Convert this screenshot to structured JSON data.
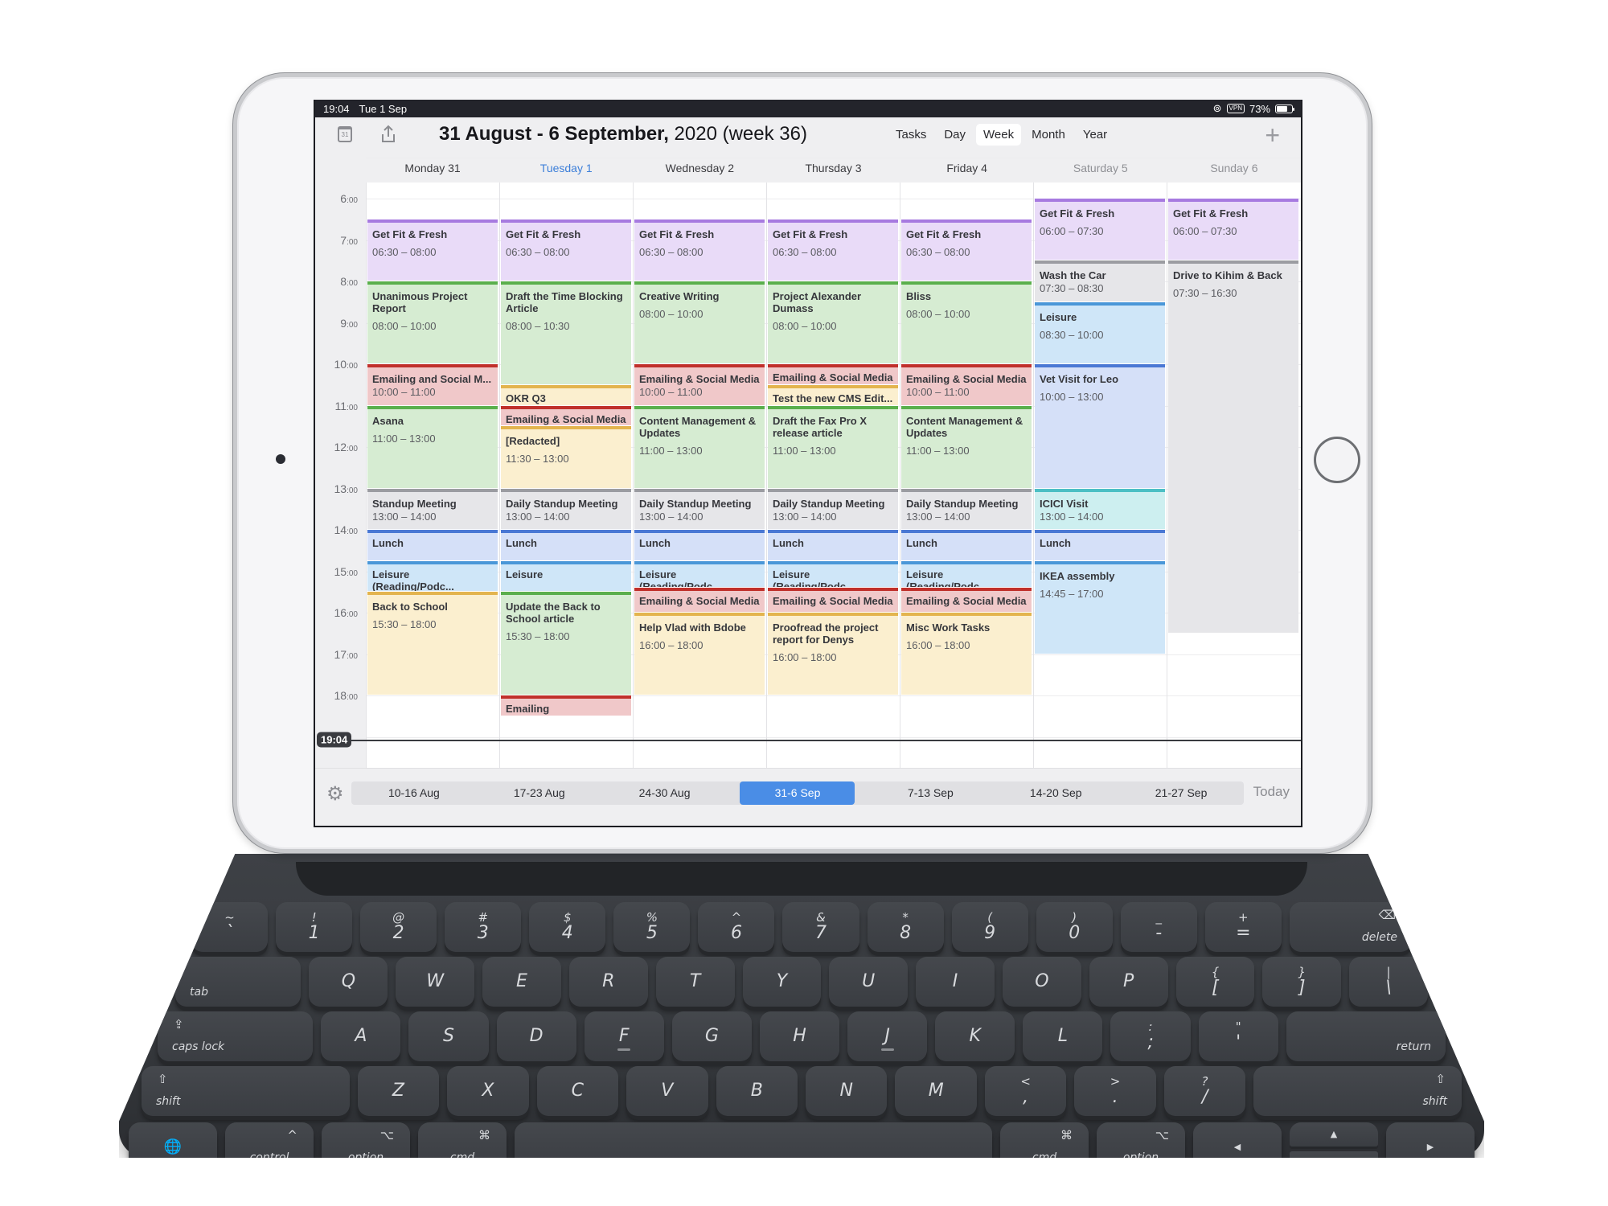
{
  "status_bar": {
    "time": "19:04",
    "date": "Tue 1 Sep",
    "vpn_label": "VPN",
    "battery_percent": "73%",
    "battery_level": 0.73
  },
  "toolbar": {
    "title_bold": "31 August - 6 September,",
    "title_rest": " 2020 (week 36)",
    "calendar_icon_day": "31",
    "view_tabs": [
      {
        "label": "Tasks",
        "active": false
      },
      {
        "label": "Day",
        "active": false
      },
      {
        "label": "Week",
        "active": true
      },
      {
        "label": "Month",
        "active": false
      },
      {
        "label": "Year",
        "active": false
      }
    ],
    "add_label": "+"
  },
  "days": [
    {
      "label": "Monday 31",
      "state": "normal"
    },
    {
      "label": "Tuesday 1",
      "state": "today"
    },
    {
      "label": "Wednesday 2",
      "state": "normal"
    },
    {
      "label": "Thursday 3",
      "state": "normal"
    },
    {
      "label": "Friday 4",
      "state": "normal"
    },
    {
      "label": "Saturday 5",
      "state": "weekend"
    },
    {
      "label": "Sunday 6",
      "state": "weekend"
    }
  ],
  "hours": [
    "6",
    "7",
    "8",
    "9",
    "10",
    "11",
    "12",
    "13",
    "14",
    "15",
    "16",
    "17",
    "18"
  ],
  "hour_suffix": ":00",
  "now": {
    "label": "19:04",
    "hour": 19.0667
  },
  "colors": {
    "purple": {
      "bg": "#e9dbf8",
      "bar": "#a77ae0"
    },
    "green": {
      "bg": "#d6ecd2",
      "bar": "#5aaf4c"
    },
    "red": {
      "bg": "#f0c8c9",
      "bar": "#c0302b"
    },
    "yellow": {
      "bg": "#fbefcf",
      "bar": "#e3b44e"
    },
    "gray": {
      "bg": "#e6e6e9",
      "bar": "#9b9ca1"
    },
    "blue": {
      "bg": "#d5e0f8",
      "bar": "#4a78d4"
    },
    "sky": {
      "bg": "#cfe6f8",
      "bar": "#4a97d8"
    },
    "teal": {
      "bg": "#cdeff0",
      "bar": "#4bbfc4"
    },
    "accent": "#4a8de6",
    "today_text": "#3d7fd9"
  },
  "events": [
    {
      "day": 0,
      "title": "Get Fit & Fresh",
      "time": "06:30 – 08:00",
      "start": 6.5,
      "end": 8,
      "color": "purple"
    },
    {
      "day": 0,
      "title": "Unanimous Project Report",
      "time": "08:00 – 10:00",
      "start": 8,
      "end": 10,
      "color": "green"
    },
    {
      "day": 0,
      "title": "Emailing and Social M...",
      "time": "10:00 – 11:00",
      "start": 10,
      "end": 11,
      "color": "red",
      "compact": true
    },
    {
      "day": 0,
      "title": "Asana",
      "time": "11:00 – 13:00",
      "start": 11,
      "end": 13,
      "color": "green"
    },
    {
      "day": 0,
      "title": "Standup Meeting",
      "time": "13:00 – 14:00",
      "start": 13,
      "end": 14,
      "color": "gray",
      "compact": true
    },
    {
      "day": 0,
      "title": "Lunch",
      "time": "",
      "start": 14,
      "end": 14.75,
      "color": "blue"
    },
    {
      "day": 0,
      "title": "Leisure (Reading/Podc...",
      "time": "",
      "start": 14.75,
      "end": 15.5,
      "color": "sky"
    },
    {
      "day": 0,
      "title": "Back to School",
      "time": "15:30 – 18:00",
      "start": 15.5,
      "end": 18,
      "color": "yellow"
    },
    {
      "day": 1,
      "title": "Get Fit & Fresh",
      "time": "06:30 – 08:00",
      "start": 6.5,
      "end": 8,
      "color": "purple"
    },
    {
      "day": 1,
      "title": "Draft the Time Blocking Article",
      "time": "08:00 – 10:30",
      "start": 8,
      "end": 10.5,
      "color": "green"
    },
    {
      "day": 1,
      "title": "OKR Q3",
      "time": "",
      "start": 10.5,
      "end": 11,
      "color": "yellow"
    },
    {
      "day": 1,
      "title": "Emailing & Social Media",
      "time": "",
      "start": 11,
      "end": 11.5,
      "color": "red"
    },
    {
      "day": 1,
      "title": "[Redacted]",
      "time": "11:30 – 13:00",
      "start": 11.5,
      "end": 13,
      "color": "yellow"
    },
    {
      "day": 1,
      "title": "Daily Standup Meeting",
      "time": "13:00 – 14:00",
      "start": 13,
      "end": 14,
      "color": "gray",
      "compact": true
    },
    {
      "day": 1,
      "title": "Lunch",
      "time": "",
      "start": 14,
      "end": 14.75,
      "color": "blue"
    },
    {
      "day": 1,
      "title": "Leisure",
      "time": "",
      "start": 14.75,
      "end": 15.5,
      "color": "sky"
    },
    {
      "day": 1,
      "title": "Update the Back to School article",
      "time": "15:30 – 18:00",
      "start": 15.5,
      "end": 18,
      "color": "green"
    },
    {
      "day": 1,
      "title": "Emailing",
      "time": "",
      "start": 18,
      "end": 18.5,
      "color": "red"
    },
    {
      "day": 2,
      "title": "Get Fit & Fresh",
      "time": "06:30 – 08:00",
      "start": 6.5,
      "end": 8,
      "color": "purple"
    },
    {
      "day": 2,
      "title": "Creative Writing",
      "time": "08:00 – 10:00",
      "start": 8,
      "end": 10,
      "color": "green"
    },
    {
      "day": 2,
      "title": "Emailing & Social Media",
      "time": "10:00 – 11:00",
      "start": 10,
      "end": 11,
      "color": "red",
      "compact": true
    },
    {
      "day": 2,
      "title": "Content Management & Updates",
      "time": "11:00 – 13:00",
      "start": 11,
      "end": 13,
      "color": "green"
    },
    {
      "day": 2,
      "title": "Daily Standup Meeting",
      "time": "13:00 – 14:00",
      "start": 13,
      "end": 14,
      "color": "gray",
      "compact": true
    },
    {
      "day": 2,
      "title": "Lunch",
      "time": "",
      "start": 14,
      "end": 14.75,
      "color": "blue"
    },
    {
      "day": 2,
      "title": "Leisure (Reading/Podc...",
      "time": "",
      "start": 14.75,
      "end": 15.4,
      "color": "sky"
    },
    {
      "day": 2,
      "title": "Emailing & Social Media",
      "time": "",
      "start": 15.4,
      "end": 16,
      "color": "red"
    },
    {
      "day": 2,
      "title": "Help Vlad with Bdobe",
      "time": "16:00 – 18:00",
      "start": 16,
      "end": 18,
      "color": "yellow"
    },
    {
      "day": 3,
      "title": "Get Fit & Fresh",
      "time": "06:30 – 08:00",
      "start": 6.5,
      "end": 8,
      "color": "purple"
    },
    {
      "day": 3,
      "title": "Project Alexander Dumass",
      "time": "08:00 – 10:00",
      "start": 8,
      "end": 10,
      "color": "green"
    },
    {
      "day": 3,
      "title": "Emailing & Social Media",
      "time": "",
      "start": 10,
      "end": 10.5,
      "color": "red"
    },
    {
      "day": 3,
      "title": "Test the new CMS Edit...",
      "time": "",
      "start": 10.5,
      "end": 11,
      "color": "yellow"
    },
    {
      "day": 3,
      "title": "Draft the Fax Pro X release article",
      "time": "11:00 – 13:00",
      "start": 11,
      "end": 13,
      "color": "green"
    },
    {
      "day": 3,
      "title": "Daily Standup Meeting",
      "time": "13:00 – 14:00",
      "start": 13,
      "end": 14,
      "color": "gray",
      "compact": true
    },
    {
      "day": 3,
      "title": "Lunch",
      "time": "",
      "start": 14,
      "end": 14.75,
      "color": "blue"
    },
    {
      "day": 3,
      "title": "Leisure (Reading/Podc...",
      "time": "",
      "start": 14.75,
      "end": 15.4,
      "color": "sky"
    },
    {
      "day": 3,
      "title": "Emailing & Social Media",
      "time": "",
      "start": 15.4,
      "end": 16,
      "color": "red"
    },
    {
      "day": 3,
      "title": "Proofread the project report for Denys",
      "time": "16:00 – 18:00",
      "start": 16,
      "end": 18,
      "color": "yellow"
    },
    {
      "day": 4,
      "title": "Get Fit & Fresh",
      "time": "06:30 – 08:00",
      "start": 6.5,
      "end": 8,
      "color": "purple"
    },
    {
      "day": 4,
      "title": "Bliss",
      "time": "08:00 – 10:00",
      "start": 8,
      "end": 10,
      "color": "green"
    },
    {
      "day": 4,
      "title": "Emailing & Social Media",
      "time": "10:00 – 11:00",
      "start": 10,
      "end": 11,
      "color": "red",
      "compact": true
    },
    {
      "day": 4,
      "title": "Content Management & Updates",
      "time": "11:00 – 13:00",
      "start": 11,
      "end": 13,
      "color": "green"
    },
    {
      "day": 4,
      "title": "Daily Standup Meeting",
      "time": "13:00 – 14:00",
      "start": 13,
      "end": 14,
      "color": "gray",
      "compact": true
    },
    {
      "day": 4,
      "title": "Lunch",
      "time": "",
      "start": 14,
      "end": 14.75,
      "color": "blue"
    },
    {
      "day": 4,
      "title": "Leisure (Reading/Podc...",
      "time": "",
      "start": 14.75,
      "end": 15.4,
      "color": "sky"
    },
    {
      "day": 4,
      "title": "Emailing & Social Media",
      "time": "",
      "start": 15.4,
      "end": 16,
      "color": "red"
    },
    {
      "day": 4,
      "title": "Misc Work Tasks",
      "time": "16:00 – 18:00",
      "start": 16,
      "end": 18,
      "color": "yellow"
    },
    {
      "day": 5,
      "title": "Get Fit & Fresh",
      "time": "06:00 – 07:30",
      "start": 6,
      "end": 7.5,
      "color": "purple"
    },
    {
      "day": 5,
      "title": "Wash the Car",
      "time": "07:30 – 08:30",
      "start": 7.5,
      "end": 8.5,
      "color": "gray",
      "compact": true
    },
    {
      "day": 5,
      "title": "Leisure",
      "time": "08:30 – 10:00",
      "start": 8.5,
      "end": 10,
      "color": "sky"
    },
    {
      "day": 5,
      "title": "Vet Visit for Leo",
      "time": "10:00 – 13:00",
      "start": 10,
      "end": 13,
      "color": "blue"
    },
    {
      "day": 5,
      "title": "ICICI Visit",
      "time": "13:00 – 14:00",
      "start": 13,
      "end": 14,
      "color": "teal",
      "compact": true
    },
    {
      "day": 5,
      "title": "Lunch",
      "time": "",
      "start": 14,
      "end": 14.75,
      "color": "blue"
    },
    {
      "day": 5,
      "title": "IKEA assembly",
      "time": "14:45 – 17:00",
      "start": 14.75,
      "end": 17,
      "color": "sky"
    },
    {
      "day": 6,
      "title": "Get Fit & Fresh",
      "time": "06:00 – 07:30",
      "start": 6,
      "end": 7.5,
      "color": "purple"
    },
    {
      "day": 6,
      "title": "Drive to Kihim & Back",
      "time": "07:30 – 16:30",
      "start": 7.5,
      "end": 16.5,
      "color": "gray"
    }
  ],
  "week_strip": {
    "weeks": [
      {
        "label": "10-16 Aug",
        "active": false
      },
      {
        "label": "17-23 Aug",
        "active": false
      },
      {
        "label": "24-30 Aug",
        "active": false
      },
      {
        "label": "31-6 Sep",
        "active": true
      },
      {
        "label": "7-13 Sep",
        "active": false
      },
      {
        "label": "14-20 Sep",
        "active": false
      },
      {
        "label": "21-27 Sep",
        "active": false
      }
    ],
    "today_label": "Today"
  },
  "keyboard": {
    "rows": [
      [
        {
          "main": "`",
          "shift": "~"
        },
        {
          "main": "1",
          "shift": "!"
        },
        {
          "main": "2",
          "shift": "@"
        },
        {
          "main": "3",
          "shift": "#"
        },
        {
          "main": "4",
          "shift": "$"
        },
        {
          "main": "5",
          "shift": "%"
        },
        {
          "main": "6",
          "shift": "^"
        },
        {
          "main": "7",
          "shift": "&"
        },
        {
          "main": "8",
          "shift": "*"
        },
        {
          "main": "9",
          "shift": "("
        },
        {
          "main": "0",
          "shift": ")"
        },
        {
          "main": "-",
          "shift": "_"
        },
        {
          "main": "=",
          "shift": "+"
        },
        {
          "mod": "delete",
          "sym": "⌫"
        }
      ],
      [
        {
          "mod": "tab"
        },
        {
          "main": "Q"
        },
        {
          "main": "W"
        },
        {
          "main": "E"
        },
        {
          "main": "R"
        },
        {
          "main": "T"
        },
        {
          "main": "Y"
        },
        {
          "main": "U"
        },
        {
          "main": "I"
        },
        {
          "main": "O"
        },
        {
          "main": "P"
        },
        {
          "main": "[",
          "shift": "{"
        },
        {
          "main": "]",
          "shift": "}"
        },
        {
          "main": "\\",
          "shift": "|"
        }
      ],
      [
        {
          "mod": "caps lock",
          "sym": "⇪"
        },
        {
          "main": "A"
        },
        {
          "main": "S"
        },
        {
          "main": "D"
        },
        {
          "main": "F",
          "bump": true
        },
        {
          "main": "G"
        },
        {
          "main": "H"
        },
        {
          "main": "J",
          "bump": true
        },
        {
          "main": "K"
        },
        {
          "main": "L"
        },
        {
          "main": ";",
          "shift": ":"
        },
        {
          "main": "'",
          "shift": "\""
        },
        {
          "mod": "return"
        }
      ],
      [
        {
          "mod": "shift",
          "sym": "⇧"
        },
        {
          "main": "Z"
        },
        {
          "main": "X"
        },
        {
          "main": "C"
        },
        {
          "main": "V"
        },
        {
          "main": "B"
        },
        {
          "main": "N"
        },
        {
          "main": "M"
        },
        {
          "main": ",",
          "shift": "<"
        },
        {
          "main": ".",
          "shift": ">"
        },
        {
          "main": "/",
          "shift": "?"
        },
        {
          "mod": "shift",
          "sym": "⇧"
        }
      ],
      [
        {
          "mod": "",
          "sym": "🌐"
        },
        {
          "mod": "control",
          "sym": "^"
        },
        {
          "mod": "option",
          "sym": "⌥"
        },
        {
          "mod": "cmd",
          "sym": "⌘"
        },
        {
          "space": true
        },
        {
          "mod": "cmd",
          "sym": "⌘"
        },
        {
          "mod": "option",
          "sym": "⌥"
        },
        {
          "arrow": "◀"
        },
        {
          "arrow_up": "▲",
          "arrow_down": "▼"
        },
        {
          "arrow": "▶"
        }
      ]
    ]
  }
}
